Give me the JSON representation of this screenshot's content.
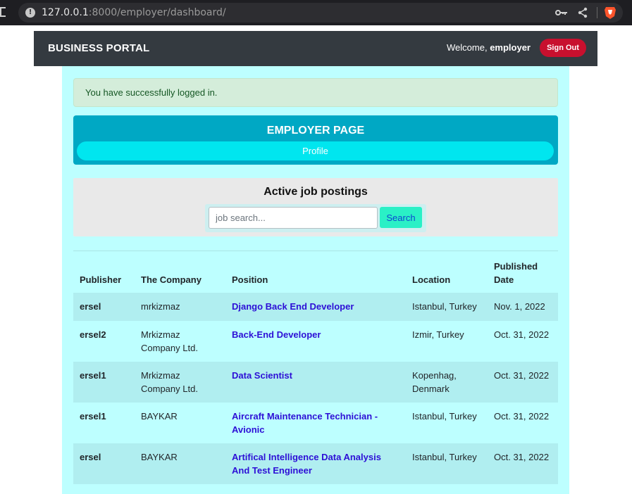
{
  "browser": {
    "url_host": "127.0.0.1",
    "url_rest": ":8000/employer/dashboard/"
  },
  "navbar": {
    "brand": "BUSINESS PORTAL",
    "welcome_prefix": "Welcome,",
    "username": "employer",
    "signout_label": "Sign Out"
  },
  "alert": {
    "message": "You have successfully logged in."
  },
  "employer_card": {
    "title": "EMPLOYER PAGE",
    "profile_label": "Profile"
  },
  "search": {
    "title": "Active job postings",
    "placeholder": "job search...",
    "button_label": "Search"
  },
  "table": {
    "headers": [
      "Publisher",
      "The Company",
      "Position",
      "Location",
      "Published Date"
    ],
    "rows": [
      {
        "publisher": "ersel",
        "company": "mrkizmaz",
        "position": "Django Back End Developer",
        "location": "Istanbul, Turkey",
        "date": "Nov. 1, 2022"
      },
      {
        "publisher": "ersel2",
        "company": "Mrkizmaz Company Ltd.",
        "position": "Back-End Developer",
        "location": "Izmir, Turkey",
        "date": "Oct. 31, 2022"
      },
      {
        "publisher": "ersel1",
        "company": "Mrkizmaz Company Ltd.",
        "position": "Data Scientist",
        "location": "Kopenhag, Denmark",
        "date": "Oct. 31, 2022"
      },
      {
        "publisher": "ersel1",
        "company": "BAYKAR",
        "position": "Aircraft Maintenance Technician - Avionic",
        "location": "Istanbul, Turkey",
        "date": "Oct. 31, 2022"
      },
      {
        "publisher": "ersel",
        "company": "BAYKAR",
        "position": "Artifical Intelligence Data Analysis And Test Engineer",
        "location": "Istanbul, Turkey",
        "date": "Oct. 31, 2022"
      }
    ]
  }
}
